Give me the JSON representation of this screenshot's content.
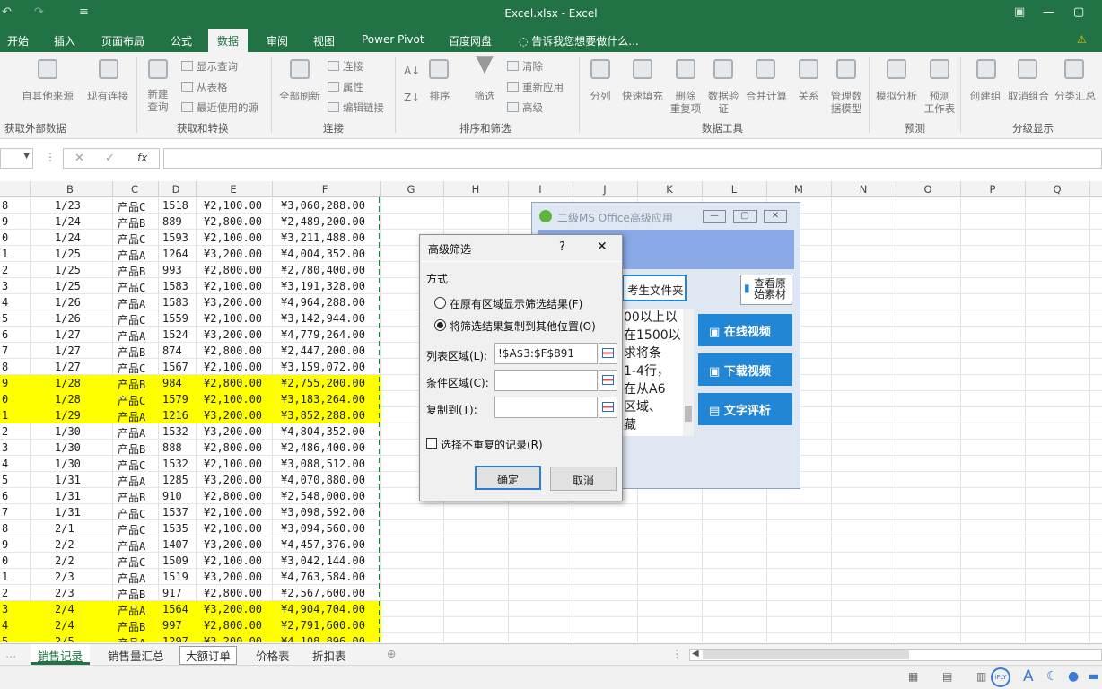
{
  "window": {
    "title": "Excel.xlsx - Excel"
  },
  "tabs": [
    "开始",
    "插入",
    "页面布局",
    "公式",
    "数据",
    "审阅",
    "视图",
    "Power Pivot",
    "百度网盘"
  ],
  "tell_me": "告诉我您想要做什么...",
  "ribbon": {
    "get_external": "自其他来源",
    "existing_conn": "现有连接",
    "new_query": "新建\n查询",
    "show_query": "显示查询",
    "from_table": "从表格",
    "recent_source": "最近使用的源",
    "refresh_all": "全部刷新",
    "connections": "连接",
    "properties": "属性",
    "edit_links": "编辑链接",
    "sort": "排序",
    "filter": "筛选",
    "clear": "清除",
    "reapply": "重新应用",
    "advanced": "高级",
    "split": "分列",
    "flash_fill": "快速填充",
    "remove_dup": "删除\n重复项",
    "data_valid": "数据验\n证",
    "consolidate": "合并计算",
    "relations": "关系",
    "manage_model": "管理数\n据模型",
    "what_if": "模拟分析",
    "forecast": "预测\n工作表",
    "group": "创建组",
    "ungroup": "取消组合",
    "subtotal": "分类汇总",
    "groups": [
      "获取外部数据",
      "获取和转换",
      "连接",
      "排序和筛选",
      "数据工具",
      "预测",
      "分级显示"
    ]
  },
  "formula_bar": {
    "fx": "fx",
    "value": ""
  },
  "columns": [
    "B",
    "C",
    "D",
    "E",
    "F",
    "G",
    "H",
    "I",
    "J",
    "K",
    "L",
    "M",
    "N",
    "O",
    "P",
    "Q"
  ],
  "rows": [
    {
      "n": "8",
      "b": "1/23",
      "c": "产品C",
      "d": "1518",
      "e": "¥2,100.00",
      "f": "¥3,060,288.00",
      "hl": false
    },
    {
      "n": "9",
      "b": "1/24",
      "c": "产品B",
      "d": "889",
      "e": "¥2,800.00",
      "f": "¥2,489,200.00",
      "hl": false
    },
    {
      "n": "0",
      "b": "1/24",
      "c": "产品C",
      "d": "1593",
      "e": "¥2,100.00",
      "f": "¥3,211,488.00",
      "hl": false
    },
    {
      "n": "1",
      "b": "1/25",
      "c": "产品A",
      "d": "1264",
      "e": "¥3,200.00",
      "f": "¥4,004,352.00",
      "hl": false
    },
    {
      "n": "2",
      "b": "1/25",
      "c": "产品B",
      "d": "993",
      "e": "¥2,800.00",
      "f": "¥2,780,400.00",
      "hl": false
    },
    {
      "n": "3",
      "b": "1/25",
      "c": "产品C",
      "d": "1583",
      "e": "¥2,100.00",
      "f": "¥3,191,328.00",
      "hl": false
    },
    {
      "n": "4",
      "b": "1/26",
      "c": "产品A",
      "d": "1583",
      "e": "¥3,200.00",
      "f": "¥4,964,288.00",
      "hl": false
    },
    {
      "n": "5",
      "b": "1/26",
      "c": "产品C",
      "d": "1559",
      "e": "¥2,100.00",
      "f": "¥3,142,944.00",
      "hl": false
    },
    {
      "n": "6",
      "b": "1/27",
      "c": "产品A",
      "d": "1524",
      "e": "¥3,200.00",
      "f": "¥4,779,264.00",
      "hl": false
    },
    {
      "n": "7",
      "b": "1/27",
      "c": "产品B",
      "d": "874",
      "e": "¥2,800.00",
      "f": "¥2,447,200.00",
      "hl": false
    },
    {
      "n": "8",
      "b": "1/27",
      "c": "产品C",
      "d": "1567",
      "e": "¥2,100.00",
      "f": "¥3,159,072.00",
      "hl": false
    },
    {
      "n": "9",
      "b": "1/28",
      "c": "产品B",
      "d": "984",
      "e": "¥2,800.00",
      "f": "¥2,755,200.00",
      "hl": true
    },
    {
      "n": "0",
      "b": "1/28",
      "c": "产品C",
      "d": "1579",
      "e": "¥2,100.00",
      "f": "¥3,183,264.00",
      "hl": true
    },
    {
      "n": "1",
      "b": "1/29",
      "c": "产品A",
      "d": "1216",
      "e": "¥3,200.00",
      "f": "¥3,852,288.00",
      "hl": true
    },
    {
      "n": "2",
      "b": "1/30",
      "c": "产品A",
      "d": "1532",
      "e": "¥3,200.00",
      "f": "¥4,804,352.00",
      "hl": false
    },
    {
      "n": "3",
      "b": "1/30",
      "c": "产品B",
      "d": "888",
      "e": "¥2,800.00",
      "f": "¥2,486,400.00",
      "hl": false
    },
    {
      "n": "4",
      "b": "1/30",
      "c": "产品C",
      "d": "1532",
      "e": "¥2,100.00",
      "f": "¥3,088,512.00",
      "hl": false
    },
    {
      "n": "5",
      "b": "1/31",
      "c": "产品A",
      "d": "1285",
      "e": "¥3,200.00",
      "f": "¥4,070,880.00",
      "hl": false
    },
    {
      "n": "6",
      "b": "1/31",
      "c": "产品B",
      "d": "910",
      "e": "¥2,800.00",
      "f": "¥2,548,000.00",
      "hl": false
    },
    {
      "n": "7",
      "b": "1/31",
      "c": "产品C",
      "d": "1537",
      "e": "¥2,100.00",
      "f": "¥3,098,592.00",
      "hl": false
    },
    {
      "n": "8",
      "b": "2/1",
      "c": "产品C",
      "d": "1535",
      "e": "¥2,100.00",
      "f": "¥3,094,560.00",
      "hl": false
    },
    {
      "n": "9",
      "b": "2/2",
      "c": "产品A",
      "d": "1407",
      "e": "¥3,200.00",
      "f": "¥4,457,376.00",
      "hl": false
    },
    {
      "n": "0",
      "b": "2/2",
      "c": "产品C",
      "d": "1509",
      "e": "¥2,100.00",
      "f": "¥3,042,144.00",
      "hl": false
    },
    {
      "n": "1",
      "b": "2/3",
      "c": "产品A",
      "d": "1519",
      "e": "¥3,200.00",
      "f": "¥4,763,584.00",
      "hl": false
    },
    {
      "n": "2",
      "b": "2/3",
      "c": "产品B",
      "d": "917",
      "e": "¥2,800.00",
      "f": "¥2,567,600.00",
      "hl": false
    },
    {
      "n": "3",
      "b": "2/4",
      "c": "产品A",
      "d": "1564",
      "e": "¥3,200.00",
      "f": "¥4,904,704.00",
      "hl": true
    },
    {
      "n": "4",
      "b": "2/4",
      "c": "产品B",
      "d": "997",
      "e": "¥2,800.00",
      "f": "¥2,791,600.00",
      "hl": true
    },
    {
      "n": "5",
      "b": "2/5",
      "c": "产品A",
      "d": "1297",
      "e": "¥3,200.00",
      "f": "¥4,108,896.00",
      "hl": true
    }
  ],
  "sheets": [
    "销售记录",
    "销售量汇总",
    "大额订单",
    "价格表",
    "折扣表"
  ],
  "active_sheet": "销售记录",
  "popup": {
    "title": "二级MS Office高级应用",
    "folder_btn": "考生文件夹",
    "view_btn": "查看原始素材",
    "text_lines": [
      "00以上以",
      "在1500以",
      "求将条",
      "1-4行，",
      "在从A6",
      "区域、",
      "藏"
    ],
    "buttons": [
      "在线视频",
      "下载视频",
      "文字评析"
    ]
  },
  "dialog": {
    "title": "高级筛选",
    "help": "?",
    "close": "✕",
    "mode_label": "方式",
    "opt1": "在原有区域显示筛选结果(F)",
    "opt2": "将筛选结果复制到其他位置(O)",
    "list_label": "列表区域(L):",
    "list_value": "!$A$3:$F$891",
    "criteria_label": "条件区域(C):",
    "criteria_value": "",
    "copy_label": "复制到(T):",
    "copy_value": "",
    "unique_label": "选择不重复的记录(R)",
    "ok": "确定",
    "cancel": "取消"
  }
}
